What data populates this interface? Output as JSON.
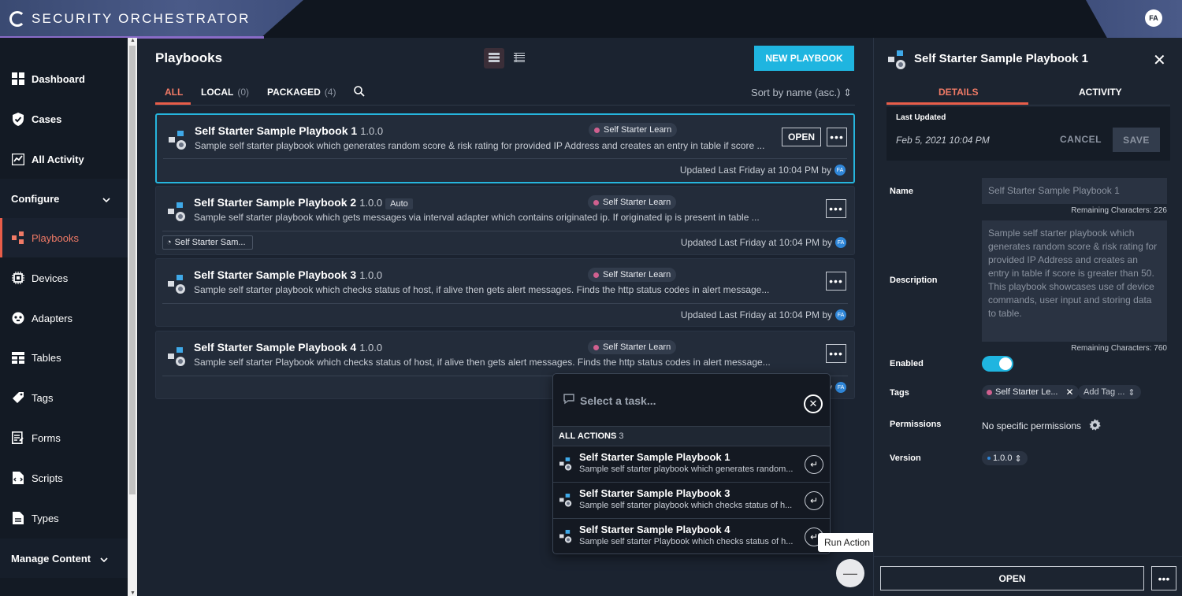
{
  "app": {
    "brand": "SECURITY ORCHESTRATOR",
    "user_initials": "FA"
  },
  "sidebar": {
    "items": [
      {
        "label": "Dashboard",
        "icon": "dashboard-icon"
      },
      {
        "label": "Cases",
        "icon": "shield-check-icon"
      },
      {
        "label": "All Activity",
        "icon": "activity-chart-icon"
      }
    ],
    "configure_label": "Configure",
    "config_items": [
      {
        "label": "Playbooks",
        "icon": "playbook-icon",
        "active": true
      },
      {
        "label": "Devices",
        "icon": "device-chip-icon"
      },
      {
        "label": "Adapters",
        "icon": "adapter-icon"
      },
      {
        "label": "Tables",
        "icon": "table-icon"
      },
      {
        "label": "Tags",
        "icon": "tag-icon"
      },
      {
        "label": "Forms",
        "icon": "form-icon"
      },
      {
        "label": "Scripts",
        "icon": "script-icon"
      },
      {
        "label": "Types",
        "icon": "type-doc-icon"
      }
    ],
    "manage_label": "Manage Content"
  },
  "main": {
    "title": "Playbooks",
    "new_button": "NEW PLAYBOOK",
    "tabs": [
      {
        "label": "ALL",
        "count": ""
      },
      {
        "label": "LOCAL",
        "count": "(0)"
      },
      {
        "label": "PACKAGED",
        "count": "(4)"
      }
    ],
    "sort_label": "Sort by name (asc.)",
    "open_label": "OPEN",
    "playbooks": [
      {
        "title": "Self Starter Sample Playbook 1",
        "version": "1.0.0",
        "badge": "",
        "tag": "Self Starter Learn",
        "description": "Sample self starter playbook which generates random score & risk rating for provided IP Address and creates an entry in table if score ...",
        "updated": "Updated Last Friday at 10:04 PM by",
        "ref_chip": ""
      },
      {
        "title": "Self Starter Sample Playbook 2",
        "version": "1.0.0",
        "badge": "Auto",
        "tag": "Self Starter Learn",
        "description": "Sample self starter playbook which gets messages via interval adapter which contains originated ip. If originated ip is present in table ...",
        "updated": "Updated Last Friday at 10:04 PM by",
        "ref_chip": "Self Starter Sam..."
      },
      {
        "title": "Self Starter Sample Playbook 3",
        "version": "1.0.0",
        "badge": "",
        "tag": "Self Starter Learn",
        "description": "Sample self starter playbook which checks status of host, if alive then gets alert messages. Finds the http status codes in alert message...",
        "updated": "Updated Last Friday at 10:04 PM by",
        "ref_chip": ""
      },
      {
        "title": "Self Starter Sample Playbook 4",
        "version": "1.0.0",
        "badge": "",
        "tag": "Self Starter Learn",
        "description": "Sample self starter Playbook which checks status of host, if alive then gets alert messages. Finds the http status codes in alert message...",
        "updated": "y",
        "ref_chip": ""
      }
    ]
  },
  "popup": {
    "placeholder": "Select a task...",
    "section_label": "ALL ACTIONS",
    "section_count": "3",
    "items": [
      {
        "title": "Self Starter Sample Playbook 1",
        "desc": "Sample self starter playbook which generates random..."
      },
      {
        "title": "Self Starter Sample Playbook 3",
        "desc": "Sample self starter playbook which checks status of h..."
      },
      {
        "title": "Self Starter Sample Playbook 4",
        "desc": "Sample self starter Playbook which checks status of h..."
      }
    ],
    "tooltip": "Run Action"
  },
  "panel": {
    "title": "Self Starter Sample Playbook 1",
    "tabs": [
      "DETAILS",
      "ACTIVITY"
    ],
    "last_updated_label": "Last Updated",
    "last_updated_value": "Feb 5, 2021 10:04 PM",
    "cancel": "CANCEL",
    "save": "SAVE",
    "name_label": "Name",
    "name_value": "Self Starter Sample Playbook 1",
    "name_remaining": "Remaining Characters: 226",
    "description_label": "Description",
    "description_value": "Sample self starter playbook which generates random score & risk rating for provided IP Address and creates an entry in table if score is greater than 50. This playbook showcases use of device commands, user input and storing data to table.",
    "description_remaining": "Remaining Characters: 760",
    "enabled_label": "Enabled",
    "enabled": true,
    "tags_label": "Tags",
    "tag_value": "Self Starter Le...",
    "add_tag": "Add Tag ...",
    "permissions_label": "Permissions",
    "permissions_value": "No specific permissions",
    "version_label": "Version",
    "version_value": "1.0.0",
    "footer_open": "OPEN"
  }
}
